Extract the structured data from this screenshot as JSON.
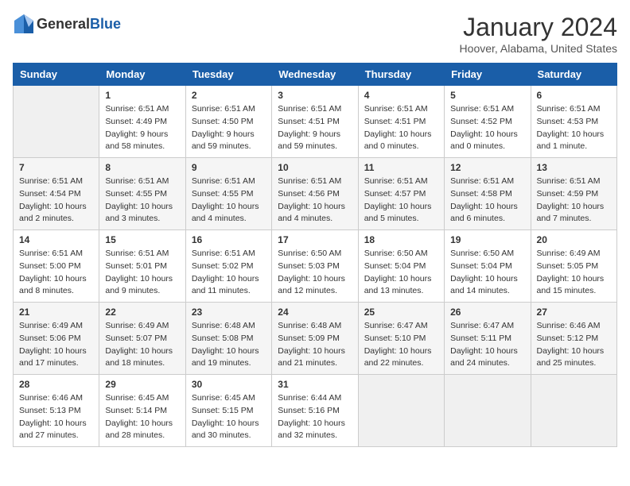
{
  "header": {
    "logo_general": "General",
    "logo_blue": "Blue",
    "title": "January 2024",
    "subtitle": "Hoover, Alabama, United States"
  },
  "calendar": {
    "days_of_week": [
      "Sunday",
      "Monday",
      "Tuesday",
      "Wednesday",
      "Thursday",
      "Friday",
      "Saturday"
    ],
    "weeks": [
      [
        {
          "day": "",
          "empty": true
        },
        {
          "day": "1",
          "sunrise": "Sunrise: 6:51 AM",
          "sunset": "Sunset: 4:49 PM",
          "daylight": "Daylight: 9 hours and 58 minutes."
        },
        {
          "day": "2",
          "sunrise": "Sunrise: 6:51 AM",
          "sunset": "Sunset: 4:50 PM",
          "daylight": "Daylight: 9 hours and 59 minutes."
        },
        {
          "day": "3",
          "sunrise": "Sunrise: 6:51 AM",
          "sunset": "Sunset: 4:51 PM",
          "daylight": "Daylight: 9 hours and 59 minutes."
        },
        {
          "day": "4",
          "sunrise": "Sunrise: 6:51 AM",
          "sunset": "Sunset: 4:51 PM",
          "daylight": "Daylight: 10 hours and 0 minutes."
        },
        {
          "day": "5",
          "sunrise": "Sunrise: 6:51 AM",
          "sunset": "Sunset: 4:52 PM",
          "daylight": "Daylight: 10 hours and 0 minutes."
        },
        {
          "day": "6",
          "sunrise": "Sunrise: 6:51 AM",
          "sunset": "Sunset: 4:53 PM",
          "daylight": "Daylight: 10 hours and 1 minute."
        }
      ],
      [
        {
          "day": "7",
          "sunrise": "Sunrise: 6:51 AM",
          "sunset": "Sunset: 4:54 PM",
          "daylight": "Daylight: 10 hours and 2 minutes."
        },
        {
          "day": "8",
          "sunrise": "Sunrise: 6:51 AM",
          "sunset": "Sunset: 4:55 PM",
          "daylight": "Daylight: 10 hours and 3 minutes."
        },
        {
          "day": "9",
          "sunrise": "Sunrise: 6:51 AM",
          "sunset": "Sunset: 4:55 PM",
          "daylight": "Daylight: 10 hours and 4 minutes."
        },
        {
          "day": "10",
          "sunrise": "Sunrise: 6:51 AM",
          "sunset": "Sunset: 4:56 PM",
          "daylight": "Daylight: 10 hours and 4 minutes."
        },
        {
          "day": "11",
          "sunrise": "Sunrise: 6:51 AM",
          "sunset": "Sunset: 4:57 PM",
          "daylight": "Daylight: 10 hours and 5 minutes."
        },
        {
          "day": "12",
          "sunrise": "Sunrise: 6:51 AM",
          "sunset": "Sunset: 4:58 PM",
          "daylight": "Daylight: 10 hours and 6 minutes."
        },
        {
          "day": "13",
          "sunrise": "Sunrise: 6:51 AM",
          "sunset": "Sunset: 4:59 PM",
          "daylight": "Daylight: 10 hours and 7 minutes."
        }
      ],
      [
        {
          "day": "14",
          "sunrise": "Sunrise: 6:51 AM",
          "sunset": "Sunset: 5:00 PM",
          "daylight": "Daylight: 10 hours and 8 minutes."
        },
        {
          "day": "15",
          "sunrise": "Sunrise: 6:51 AM",
          "sunset": "Sunset: 5:01 PM",
          "daylight": "Daylight: 10 hours and 9 minutes."
        },
        {
          "day": "16",
          "sunrise": "Sunrise: 6:51 AM",
          "sunset": "Sunset: 5:02 PM",
          "daylight": "Daylight: 10 hours and 11 minutes."
        },
        {
          "day": "17",
          "sunrise": "Sunrise: 6:50 AM",
          "sunset": "Sunset: 5:03 PM",
          "daylight": "Daylight: 10 hours and 12 minutes."
        },
        {
          "day": "18",
          "sunrise": "Sunrise: 6:50 AM",
          "sunset": "Sunset: 5:04 PM",
          "daylight": "Daylight: 10 hours and 13 minutes."
        },
        {
          "day": "19",
          "sunrise": "Sunrise: 6:50 AM",
          "sunset": "Sunset: 5:04 PM",
          "daylight": "Daylight: 10 hours and 14 minutes."
        },
        {
          "day": "20",
          "sunrise": "Sunrise: 6:49 AM",
          "sunset": "Sunset: 5:05 PM",
          "daylight": "Daylight: 10 hours and 15 minutes."
        }
      ],
      [
        {
          "day": "21",
          "sunrise": "Sunrise: 6:49 AM",
          "sunset": "Sunset: 5:06 PM",
          "daylight": "Daylight: 10 hours and 17 minutes."
        },
        {
          "day": "22",
          "sunrise": "Sunrise: 6:49 AM",
          "sunset": "Sunset: 5:07 PM",
          "daylight": "Daylight: 10 hours and 18 minutes."
        },
        {
          "day": "23",
          "sunrise": "Sunrise: 6:48 AM",
          "sunset": "Sunset: 5:08 PM",
          "daylight": "Daylight: 10 hours and 19 minutes."
        },
        {
          "day": "24",
          "sunrise": "Sunrise: 6:48 AM",
          "sunset": "Sunset: 5:09 PM",
          "daylight": "Daylight: 10 hours and 21 minutes."
        },
        {
          "day": "25",
          "sunrise": "Sunrise: 6:47 AM",
          "sunset": "Sunset: 5:10 PM",
          "daylight": "Daylight: 10 hours and 22 minutes."
        },
        {
          "day": "26",
          "sunrise": "Sunrise: 6:47 AM",
          "sunset": "Sunset: 5:11 PM",
          "daylight": "Daylight: 10 hours and 24 minutes."
        },
        {
          "day": "27",
          "sunrise": "Sunrise: 6:46 AM",
          "sunset": "Sunset: 5:12 PM",
          "daylight": "Daylight: 10 hours and 25 minutes."
        }
      ],
      [
        {
          "day": "28",
          "sunrise": "Sunrise: 6:46 AM",
          "sunset": "Sunset: 5:13 PM",
          "daylight": "Daylight: 10 hours and 27 minutes."
        },
        {
          "day": "29",
          "sunrise": "Sunrise: 6:45 AM",
          "sunset": "Sunset: 5:14 PM",
          "daylight": "Daylight: 10 hours and 28 minutes."
        },
        {
          "day": "30",
          "sunrise": "Sunrise: 6:45 AM",
          "sunset": "Sunset: 5:15 PM",
          "daylight": "Daylight: 10 hours and 30 minutes."
        },
        {
          "day": "31",
          "sunrise": "Sunrise: 6:44 AM",
          "sunset": "Sunset: 5:16 PM",
          "daylight": "Daylight: 10 hours and 32 minutes."
        },
        {
          "day": "",
          "empty": true
        },
        {
          "day": "",
          "empty": true
        },
        {
          "day": "",
          "empty": true
        }
      ]
    ]
  }
}
